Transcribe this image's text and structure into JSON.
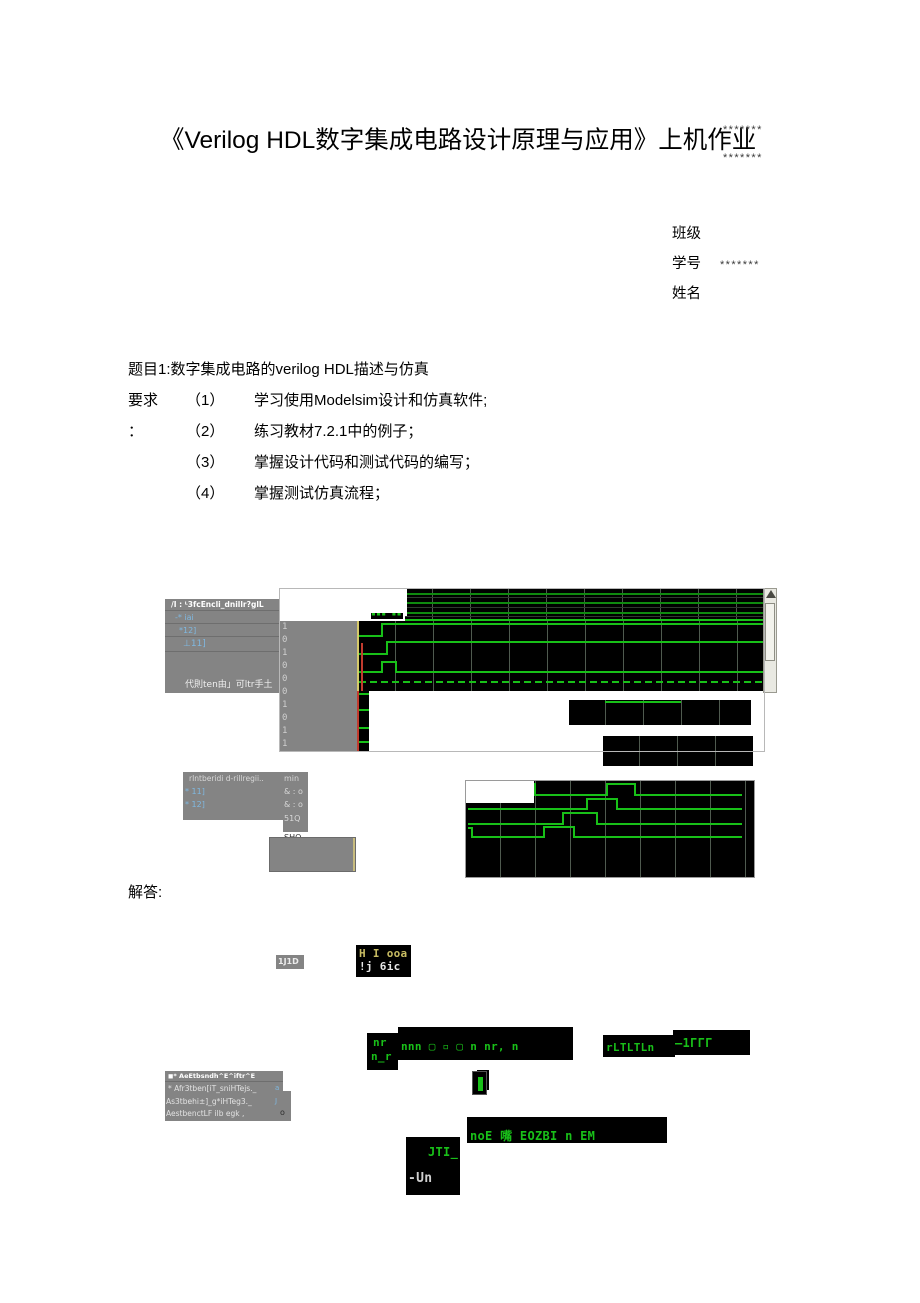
{
  "document": {
    "title": "《Verilog HDL数字集成电路设计原理与应用》上机作业",
    "stars_top_1": "*******",
    "stars_top_2": "*******",
    "info": [
      {
        "label": "班级",
        "value": ""
      },
      {
        "label": "学号",
        "value": "*******"
      },
      {
        "label": "姓名",
        "value": ""
      }
    ],
    "task_heading": "题目1:数字集成电路的verilog HDL描述与仿真",
    "requirements": [
      {
        "tag": "要求",
        "num": "（1）",
        "text": "学习使用Modelsim设计和仿真软件;"
      },
      {
        "tag": "：",
        "num": "（2）",
        "text": "练习教材7.2.1中的例子；"
      },
      {
        "tag": "",
        "num": "（3）",
        "text": "掌握设计代码和测试代码的编写；"
      },
      {
        "tag": "",
        "num": "（4）",
        "text": "掌握测试仿真流程；"
      }
    ],
    "answer_label": "解答:"
  },
  "figure1": {
    "name": "modelsim-wave-capture-top",
    "object_panel": {
      "header": "/I : ᴸ3fcEncli_dnillr?glL",
      "rows": [
        "-* iai",
        "*12]",
        "⊥11]"
      ],
      "footer": "代則ten由」可ltr手土"
    },
    "value_digits": [
      "1",
      "0",
      "1",
      "0",
      "0",
      "0",
      "1",
      "0",
      "1",
      "1"
    ]
  },
  "figure2": {
    "name": "modelsim-objects-and-wave",
    "panel_header_left": "rIntberidi  d-rillregii..",
    "panel_header_right": "min",
    "rows": [
      {
        "left": "* 11]",
        "right": "& : o"
      },
      {
        "left": "* 12]",
        "right": "& : o"
      },
      {
        "left": "",
        "right": "51Q"
      }
    ],
    "below_label": "SHO"
  },
  "figure3": {
    "name": "transcript-fragment",
    "gray_tag": "1J1D",
    "line1": "H I ooa",
    "line2": "!j 6ic"
  },
  "figure4": {
    "name": "code-fragments",
    "left_panel": {
      "header": "◼* AeEtbsndh^E^iftr^E",
      "rows": [
        "*  Afr3tben[iT_sniHTejs._",
        "As3tbehi±]_g*iHTeg3._",
        "AestbenctLF ilb egk ,"
      ],
      "right_marks": [
        "a",
        "J",
        "o"
      ]
    },
    "block_nr": {
      "line1": "nr",
      "line2": "n_r"
    },
    "block_main": "nnn  ▢  ▫  ▢  n nr, n",
    "block_i": "i",
    "block_right_1": "rLTLTLn",
    "block_right_2": "—1ΓΓΓ",
    "block_noe": "noE 嘴 EOZBI n  EM",
    "block_jtl": "JTI_",
    "block_un": "-Un"
  },
  "colors": {
    "wave_green": "#18c018",
    "wave_bg": "#000000",
    "panel_gray": "#848484",
    "cursor_yellow": "#d6c96a",
    "cursor_red": "#c23b2e",
    "page_bg": "#ffffff"
  }
}
